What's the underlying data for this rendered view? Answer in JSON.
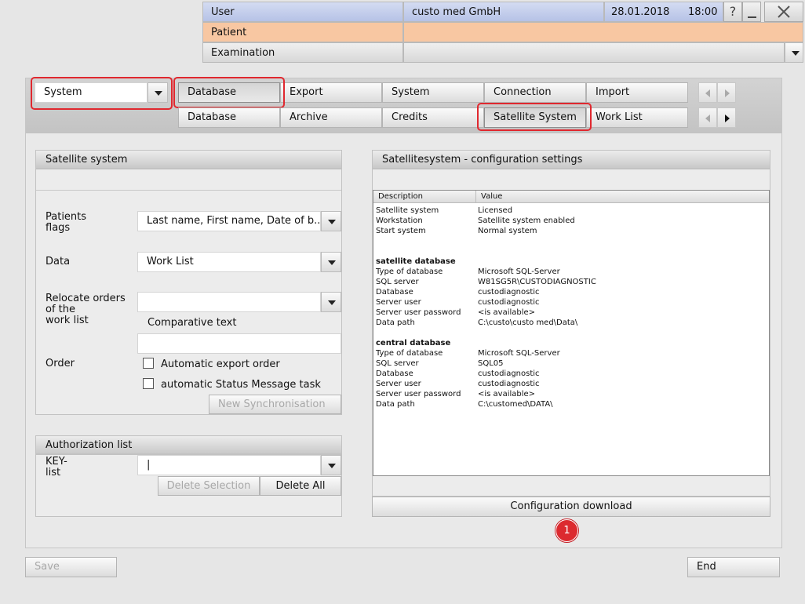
{
  "header": {
    "user_label": "User",
    "company": "custo med GmbH",
    "date": "28.01.2018",
    "time": "18:00",
    "help_icon": "question-mark",
    "minimize_icon": "minimize",
    "close_icon": "close-x",
    "patient_label": "Patient",
    "examination_label": "Examination"
  },
  "category_select": {
    "value": "System"
  },
  "tabs_row1": [
    "Database",
    "Export",
    "System",
    "Connection",
    "Import"
  ],
  "tabs_row2": [
    "Database",
    "Archive",
    "Credits",
    "Satellite System",
    "Work List"
  ],
  "satellite": {
    "title": "Satellite system",
    "patients_flags_label": "Patients\nflags",
    "patients_flags_value": "Last name, First name, Date of b...",
    "data_label": "Data",
    "data_value": "Work List",
    "relocate_label": "Relocate orders\nof the\nwork list",
    "relocate_value": "",
    "comparative_text_label": "Comparative text",
    "comparative_text_value": "",
    "order_label": "Order",
    "auto_export_label": "Automatic export order",
    "auto_status_label": "automatic Status Message task",
    "new_sync_label": "New Synchronisation"
  },
  "authorization": {
    "title": "Authorization list",
    "key_list_label": "KEY-\nlist",
    "key_list_value": "|",
    "delete_selection_label": "Delete Selection",
    "delete_all_label": "Delete All"
  },
  "config": {
    "title": "Satellitesystem - configuration settings",
    "col_description": "Description",
    "col_value": "Value",
    "rows": [
      {
        "d": "Satellite system",
        "v": "Licensed"
      },
      {
        "d": "Workstation",
        "v": "Satellite system enabled"
      },
      {
        "d": "Start system",
        "v": "Normal system"
      },
      {
        "d": "",
        "v": ""
      },
      {
        "d": "",
        "v": ""
      },
      {
        "d": "satellite database",
        "v": "",
        "bold": true
      },
      {
        "d": "Type of database",
        "v": "Microsoft SQL-Server"
      },
      {
        "d": "SQL server",
        "v": "W81SG5R\\CUSTODIAGNOSTIC"
      },
      {
        "d": "Database",
        "v": "custodiagnostic"
      },
      {
        "d": "Server user",
        "v": "custodiagnostic"
      },
      {
        "d": "Server user password",
        "v": "<is available>"
      },
      {
        "d": "Data path",
        "v": "C:\\custo\\custo med\\Data\\"
      },
      {
        "d": "",
        "v": ""
      },
      {
        "d": "central database",
        "v": "",
        "bold": true
      },
      {
        "d": "Type of database",
        "v": "Microsoft SQL-Server"
      },
      {
        "d": "SQL server",
        "v": "SQL05"
      },
      {
        "d": "Database",
        "v": "custodiagnostic"
      },
      {
        "d": "Server user",
        "v": "custodiagnostic"
      },
      {
        "d": "Server user password",
        "v": "<is available>"
      },
      {
        "d": "Data path",
        "v": "C:\\customed\\DATA\\"
      }
    ],
    "download_label": "Configuration download",
    "marker": "1"
  },
  "footer": {
    "save_label": "Save",
    "end_label": "End"
  },
  "colors": {
    "highlight": "#e0282f",
    "header_blue": "#c4cdee",
    "header_orange": "#f8c7a2"
  }
}
